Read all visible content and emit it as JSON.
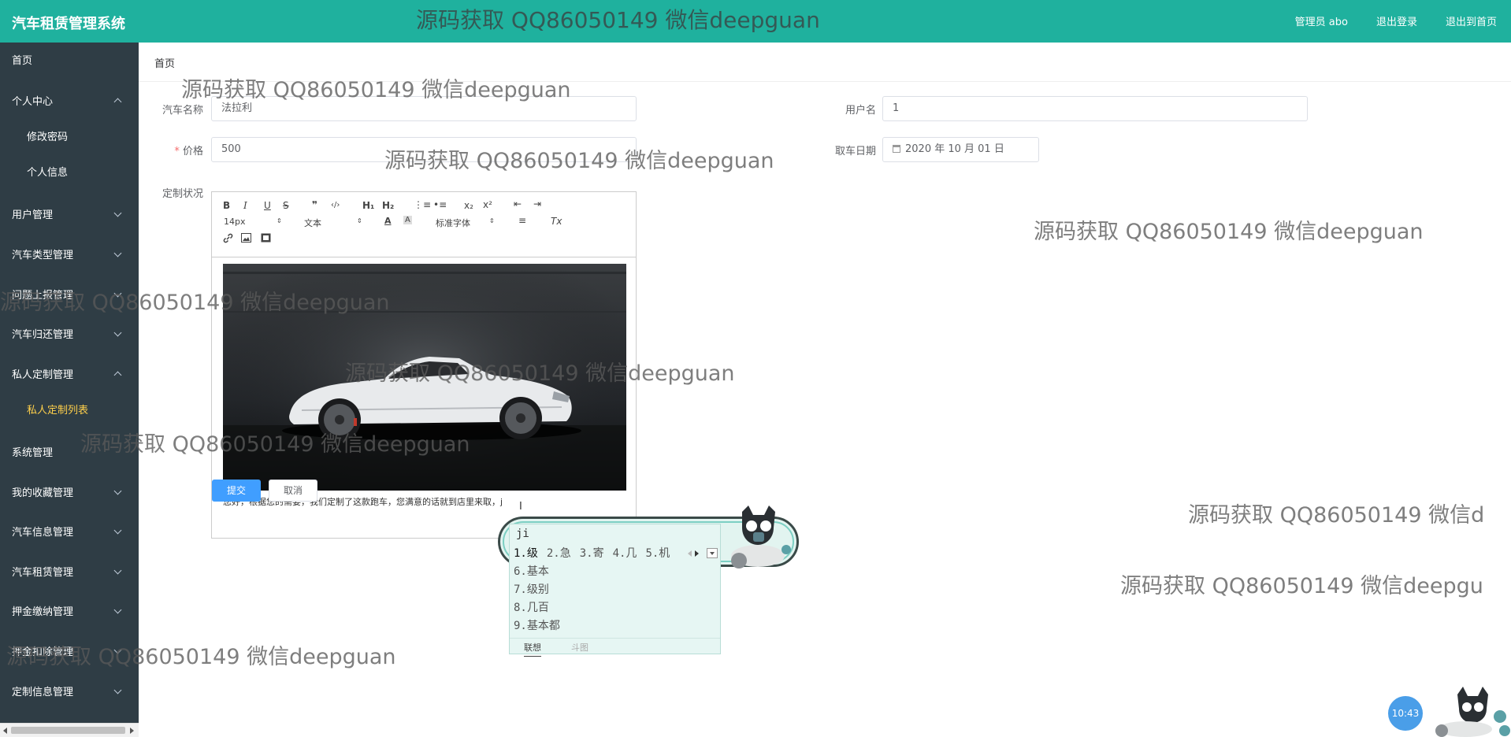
{
  "header": {
    "app_title": "汽车租赁管理系统",
    "user_label": "管理员 abo",
    "logout_label": "退出登录",
    "home_exit_label": "退出到首页"
  },
  "sidebar": {
    "items": [
      {
        "label": "首页",
        "expanded": null
      },
      {
        "label": "个人中心",
        "expanded": true
      },
      {
        "label": "修改密码",
        "sub": true
      },
      {
        "label": "个人信息",
        "sub": true
      },
      {
        "label": "用户管理",
        "expanded": false
      },
      {
        "label": "汽车类型管理",
        "expanded": false
      },
      {
        "label": "问题上报管理",
        "expanded": false
      },
      {
        "label": "汽车归还管理",
        "expanded": false
      },
      {
        "label": "私人定制管理",
        "expanded": true
      },
      {
        "label": "私人定制列表",
        "sub": true,
        "active": true
      },
      {
        "label": "系统管理",
        "expanded": null
      },
      {
        "label": "我的收藏管理",
        "expanded": false
      },
      {
        "label": "汽车信息管理",
        "expanded": false
      },
      {
        "label": "汽车租赁管理",
        "expanded": false
      },
      {
        "label": "押金缴纳管理",
        "expanded": false
      },
      {
        "label": "押金扣除管理",
        "expanded": false
      },
      {
        "label": "定制信息管理",
        "expanded": false
      }
    ]
  },
  "breadcrumb": {
    "current": "首页"
  },
  "form": {
    "car_name_label": "汽车名称",
    "car_name_value": "法拉利",
    "username_label": "用户名",
    "username_value": "1",
    "price_required_mark": "*",
    "price_label": "价格",
    "price_value": "500",
    "pickup_date_label": "取车日期",
    "pickup_date_value": "2020 年 10 月 01 日",
    "custom_status_label": "定制状况"
  },
  "editor": {
    "toolbar": {
      "bold": "B",
      "italic": "I",
      "underline": "U",
      "strike": "S",
      "quote": "❞",
      "code": "‹/›",
      "h1": "H₁",
      "h2": "H₂",
      "ordered_list": "⋮≡",
      "bullet_list": "•≡",
      "subscript": "x₂",
      "superscript": "x²",
      "font_size": "14px",
      "paragraph": "文本",
      "font_family": "标准字体",
      "clear_format": "Tx"
    },
    "content_text": "您好，根据您的需要，我们定制了这款跑车，您满意的话就到店里来取，j",
    "submit_label": "提交",
    "cancel_label": "取消"
  },
  "ime": {
    "composition": "ji",
    "candidates": [
      "1.级",
      "2.急",
      "3.寄",
      "4.几",
      "5.机"
    ],
    "extra_candidates": [
      "6.基本",
      "7.级别",
      "8.几百",
      "9.基本都"
    ],
    "tab_association": "联想",
    "tab_sticker": "斗图"
  },
  "clock": "10:43",
  "watermark": "源码获取 QQ86050149 微信deepguan",
  "watermark_partial_1": "源码获取 QQ86050149 微信d",
  "watermark_partial_2": "源码获取 QQ86050149 微信deepgu",
  "colors": {
    "header_bg": "#1fb19e",
    "sidebar_bg": "#2f3d45",
    "active_menu": "#ffd04b",
    "primary_button": "#409eff"
  }
}
